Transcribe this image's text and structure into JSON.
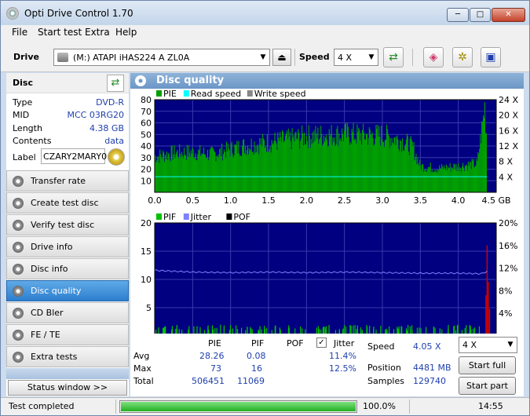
{
  "window": {
    "title": "Opti Drive Control 1.70",
    "minimize": "─",
    "maximize": "□",
    "close": "✕"
  },
  "menu": [
    "File",
    "Start test",
    "Extra",
    "Help"
  ],
  "toolbar": {
    "drive_label": "Drive",
    "drive_value": "(M:)   ATAPI iHAS224   A ZL0A",
    "speed_label": "Speed",
    "speed_value": "4 X"
  },
  "disc": {
    "header": "Disc",
    "rows": [
      {
        "key": "Type",
        "value": "DVD-R"
      },
      {
        "key": "MID",
        "value": "MCC 03RG20"
      },
      {
        "key": "Length",
        "value": "4.38 GB"
      },
      {
        "key": "Contents",
        "value": "data"
      }
    ],
    "label_key": "Label",
    "label_value": "CZARY2MARY0"
  },
  "nav": [
    "Transfer rate",
    "Create test disc",
    "Verify test disc",
    "Drive info",
    "Disc info",
    "Disc quality",
    "CD Bler",
    "FE / TE",
    "Extra tests"
  ],
  "nav_active": "Disc quality",
  "status_window_btn": "Status window >>",
  "panel_title": "Disc quality",
  "colors": {
    "pie": "#00a000",
    "read": "#00ffff",
    "write": "#888888",
    "pif": "#00c000",
    "jitter": "#8080ff",
    "pof": "#000000",
    "plot_bg": "#000080",
    "grid": "#3a3ab0",
    "spike": "#cc0000"
  },
  "chart_data": [
    {
      "type": "bar",
      "legend": [
        "PIE",
        "Read speed",
        "Write speed"
      ],
      "x_ticks": [
        "0.0",
        "0.5",
        "1.0",
        "1.5",
        "2.0",
        "2.5",
        "3.0",
        "3.5",
        "4.0",
        "4.5 GB"
      ],
      "xlim": [
        0,
        4.5
      ],
      "left_ticks": [
        "10",
        "20",
        "30",
        "40",
        "50",
        "60",
        "70",
        "80"
      ],
      "ylim": [
        0,
        80
      ],
      "right_ticks": [
        "4 X",
        "8 X",
        "12 X",
        "16 X",
        "20 X",
        "24 X"
      ],
      "y2lim": [
        0,
        24
      ],
      "pie_profile": {
        "x": [
          0,
          0.25,
          0.5,
          0.75,
          1.0,
          1.25,
          1.5,
          1.75,
          2.0,
          2.25,
          2.5,
          2.75,
          3.0,
          3.25,
          3.4,
          3.5,
          3.75,
          4.0,
          4.25,
          4.35,
          4.38
        ],
        "y": [
          30,
          33,
          34,
          32,
          36,
          40,
          42,
          44,
          47,
          48,
          49,
          48,
          48,
          44,
          38,
          22,
          20,
          22,
          24,
          72,
          40
        ]
      },
      "read_speed": {
        "x": [
          0,
          4.38
        ],
        "y": [
          4.05,
          4.05
        ]
      }
    },
    {
      "type": "bar",
      "legend": [
        "PIF",
        "Jitter",
        "POF"
      ],
      "x_ticks": [
        "0.0",
        "0.5",
        "1.0",
        "1.5",
        "2.0",
        "2.5",
        "3.0",
        "3.5",
        "4.0",
        "4.5 GB"
      ],
      "xlim": [
        0,
        4.5
      ],
      "left_ticks": [
        "5",
        "10",
        "15",
        "20"
      ],
      "ylim": [
        0,
        20
      ],
      "right_ticks": [
        "4%",
        "8%",
        "12%",
        "16%",
        "20%"
      ],
      "y2lim": [
        0,
        20
      ],
      "jitter": {
        "x": [
          0,
          0.5,
          1.0,
          1.5,
          2.0,
          2.5,
          3.0,
          3.5,
          4.0,
          4.3,
          4.38
        ],
        "y": [
          11.6,
          11.3,
          11.2,
          11.3,
          11.2,
          11.3,
          11.2,
          11.1,
          11.1,
          11.0,
          11.4
        ]
      },
      "pif_max": 2,
      "pif_spike": {
        "x": 4.38,
        "y": 16
      }
    }
  ],
  "stats": {
    "headers": [
      "PIE",
      "PIF",
      "POF",
      "Jitter"
    ],
    "rows": [
      {
        "label": "Avg",
        "pie": "28.26",
        "pif": "0.08",
        "jitter": "11.4%"
      },
      {
        "label": "Max",
        "pie": "73",
        "pif": "16",
        "jitter": "12.5%"
      },
      {
        "label": "Total",
        "pie": "506451",
        "pif": "11069"
      }
    ],
    "jitter_checked": true,
    "speed_label": "Speed",
    "speed_value": "4.05 X",
    "speed_select": "4 X",
    "position_label": "Position",
    "position_value": "4481 MB",
    "samples_label": "Samples",
    "samples_value": "129740",
    "start_full": "Start full",
    "start_part": "Start part"
  },
  "status": {
    "text": "Test completed",
    "progress": 1.0,
    "percent": "100.0%",
    "time": "14:55"
  }
}
